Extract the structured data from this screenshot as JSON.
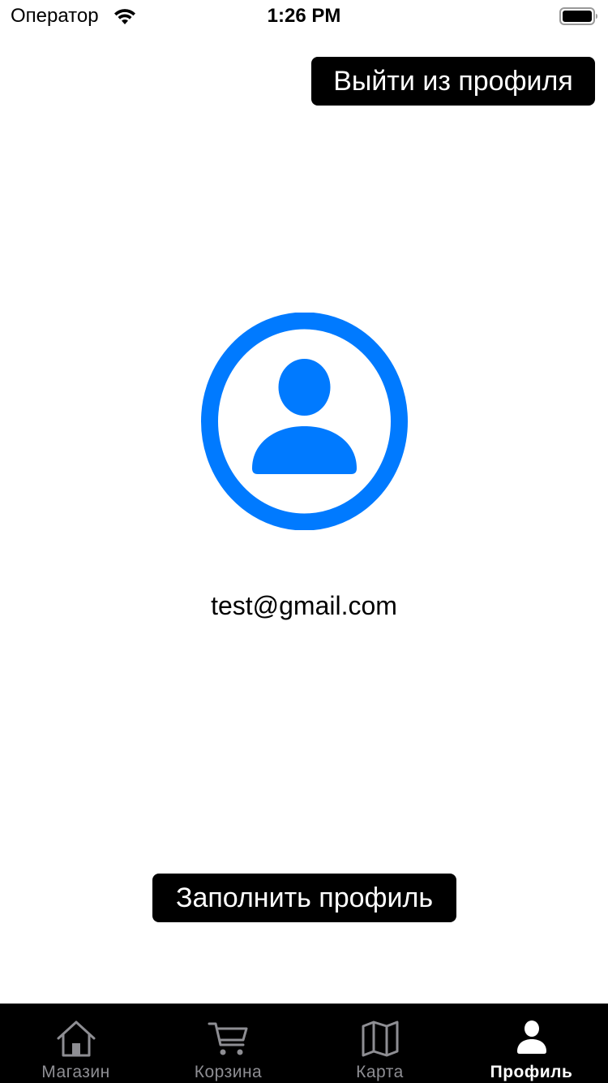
{
  "status_bar": {
    "carrier": "Оператор",
    "time": "1:26 PM"
  },
  "header": {
    "logout_label": "Выйти из профиля"
  },
  "profile": {
    "avatar_icon": "person-circle-icon",
    "email": "test@gmail.com",
    "fill_profile_label": "Заполнить профиль"
  },
  "tab_bar": {
    "tabs": [
      {
        "label": "Магазин",
        "icon": "house-icon",
        "active": false
      },
      {
        "label": "Корзина",
        "icon": "cart-icon",
        "active": false
      },
      {
        "label": "Карта",
        "icon": "map-icon",
        "active": false
      },
      {
        "label": "Профиль",
        "icon": "person-icon",
        "active": true
      }
    ]
  },
  "colors": {
    "accent": "#007AFF",
    "button_bg": "#000000",
    "tab_bar_bg": "#000000",
    "tab_inactive": "#8E8E93",
    "tab_active": "#FFFFFF"
  }
}
